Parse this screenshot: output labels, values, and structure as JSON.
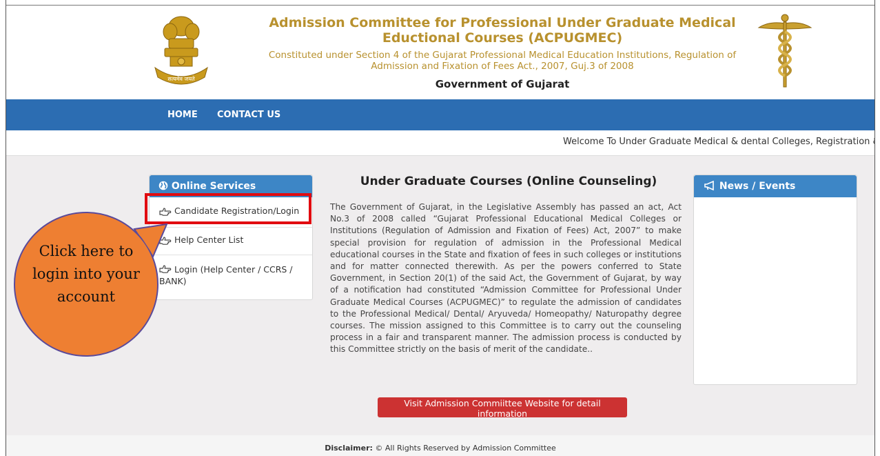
{
  "header": {
    "title": "Admission Committee for Professional Under Graduate Medical Eductional Courses (ACPUGMEC)",
    "subtitle": "Constituted under Section 4 of the Gujarat Professional Medical Education Institutions, Regulation of Admission and Fixation of Fees Act., 2007, Guj.3 of 2008",
    "government": "Government of Gujarat",
    "emblem_icon": "state-emblem-icon",
    "caduceus_icon": "caduceus-icon"
  },
  "nav": {
    "home": "HOME",
    "contact": "CONTACT US"
  },
  "marquee": {
    "text": "Welcome To Under Graduate Medical & dental Colleges, Registration & Online Counseling"
  },
  "online_services": {
    "title": "Online Services",
    "items": [
      {
        "label": "Candidate Registration/Login",
        "icon": "pointing-hand-icon"
      },
      {
        "label": "Help Center List",
        "icon": "pointing-hand-icon"
      },
      {
        "label": "Login (Help Center / CCRS / BANK)",
        "icon": "pointing-hand-icon"
      }
    ]
  },
  "main": {
    "title": "Under Graduate Courses (Online Counseling)",
    "body": "The Government of Gujarat, in the Legislative Assembly has passed an act, Act No.3 of 2008 called “Gujarat Professional Educational Medical Colleges or Institutions (Regulation of Admission and Fixation of Fees) Act, 2007” to make special provision for regulation of admission in the Professional Medical educational courses in the State and fixation of fees in such colleges or institutions and for matter connected therewith. As per the powers conferred to State Government, in Section 20(1) of the said Act, the Government of Gujarat, by way of a notification had constituted “Admission Committee for Professional Under Graduate Medical Courses (ACPUGMEC)” to regulate the admission of candidates to the Professional Medical/ Dental/ Aryuveda/ Homeopathy/ Naturopathy degree courses. The mission assigned to this Committee is to carry out the counseling process in a fair and transparent manner. The admission process is conducted by this Committee strictly on the basis of merit of the candidate..",
    "button": "Visit Admission Commiittee Website for detail information"
  },
  "news": {
    "title": "News / Events"
  },
  "footer": {
    "label": "Disclaimer:",
    "text": " © All Rights Reserved by Admission Committee"
  },
  "callout": {
    "text": "Click here to login into your account"
  },
  "colors": {
    "navbar": "#2c6db2",
    "panel_header": "#3d86c6",
    "title_gold": "#b8912e",
    "highlight_red": "#e10b10",
    "callout_orange": "#ee7f32",
    "button_red": "#cc3232"
  }
}
